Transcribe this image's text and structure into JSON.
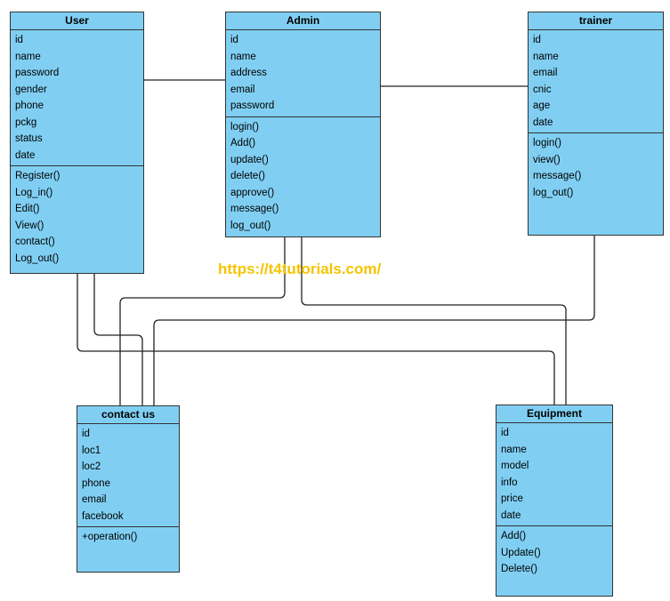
{
  "classes": {
    "user": {
      "name": "User",
      "attributes": [
        "id",
        "name",
        "password",
        "gender",
        "phone",
        "pckg",
        "status",
        "date"
      ],
      "operations": [
        "Register()",
        "Log_in()",
        "Edit()",
        "View()",
        "contact()",
        "Log_out()"
      ]
    },
    "admin": {
      "name": "Admin",
      "attributes": [
        "id",
        "name",
        "address",
        "email",
        "password"
      ],
      "operations": [
        "login()",
        "Add()",
        "update()",
        "delete()",
        "approve()",
        "message()",
        "log_out()"
      ]
    },
    "trainer": {
      "name": "trainer",
      "attributes": [
        "id",
        "name",
        "email",
        "cnic",
        "age",
        "date"
      ],
      "operations": [
        "login()",
        "view()",
        "message()",
        "log_out()"
      ]
    },
    "contact": {
      "name": "contact us",
      "attributes": [
        "id",
        "loc1",
        "loc2",
        "phone",
        "email",
        "facebook"
      ],
      "operations": [
        "+operation()"
      ]
    },
    "equipment": {
      "name": "Equipment",
      "attributes": [
        "id",
        "name",
        "model",
        "info",
        "price",
        "date"
      ],
      "operations": [
        "Add()",
        "Update()",
        "Delete()"
      ]
    }
  },
  "watermark": "https://t4tutorials.com/",
  "colors": {
    "class_fill": "#80cff3",
    "watermark": "#f5c400"
  }
}
